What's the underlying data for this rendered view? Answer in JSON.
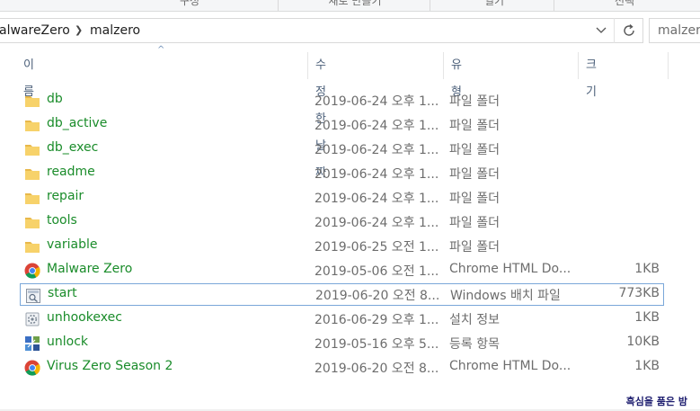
{
  "ribbon": {
    "groups": [
      {
        "label": "구성",
        "visible_part": "구성"
      },
      {
        "label": "새로 만들기"
      },
      {
        "label": "열기"
      },
      {
        "label": "선택"
      }
    ]
  },
  "address_bar": {
    "breadcrumbs": [
      "alwareZero",
      "malzero"
    ],
    "dropdown_icon": "chevron-down-icon",
    "refresh_icon": "refresh-icon"
  },
  "search": {
    "placeholder": "malzero 검색",
    "value": "malzero"
  },
  "columns": {
    "name": "이름",
    "modified": "수정한 날짜",
    "type": "유형",
    "size": "크기"
  },
  "files": [
    {
      "name": "db",
      "modified": "2019-06-24 오후 1...",
      "type": "파일 폴더",
      "size": "",
      "icon": "folder-icon"
    },
    {
      "name": "db_active",
      "modified": "2019-06-24 오후 1...",
      "type": "파일 폴더",
      "size": "",
      "icon": "folder-icon"
    },
    {
      "name": "db_exec",
      "modified": "2019-06-24 오후 1...",
      "type": "파일 폴더",
      "size": "",
      "icon": "folder-icon"
    },
    {
      "name": "readme",
      "modified": "2019-06-24 오후 1...",
      "type": "파일 폴더",
      "size": "",
      "icon": "folder-icon"
    },
    {
      "name": "repair",
      "modified": "2019-06-24 오후 1...",
      "type": "파일 폴더",
      "size": "",
      "icon": "folder-icon"
    },
    {
      "name": "tools",
      "modified": "2019-06-24 오후 1...",
      "type": "파일 폴더",
      "size": "",
      "icon": "folder-icon"
    },
    {
      "name": "variable",
      "modified": "2019-06-25 오전 1...",
      "type": "파일 폴더",
      "size": "",
      "icon": "folder-icon"
    },
    {
      "name": "Malware Zero",
      "modified": "2019-05-06 오전 1...",
      "type": "Chrome HTML Do...",
      "size": "1KB",
      "icon": "chrome-icon"
    },
    {
      "name": "start",
      "modified": "2019-06-20 오전 8...",
      "type": "Windows 배치 파일",
      "size": "773KB",
      "icon": "batch-file-icon",
      "focused": true
    },
    {
      "name": "unhookexec",
      "modified": "2016-06-29 오후 1...",
      "type": "설치 정보",
      "size": "1KB",
      "icon": "setup-info-icon"
    },
    {
      "name": "unlock",
      "modified": "2019-05-16 오후 5...",
      "type": "등록 항목",
      "size": "10KB",
      "icon": "registry-icon"
    },
    {
      "name": "Virus Zero Season 2",
      "modified": "2019-06-20 오전 8...",
      "type": "Chrome HTML Do...",
      "size": "1KB",
      "icon": "chrome-icon"
    }
  ],
  "watermark": "흑심을 품은 밤",
  "colors": {
    "filename": "#1a8c2a",
    "header_text": "#4c607a",
    "focus_border": "#7aa7d9",
    "folder": "#e8b84a"
  }
}
